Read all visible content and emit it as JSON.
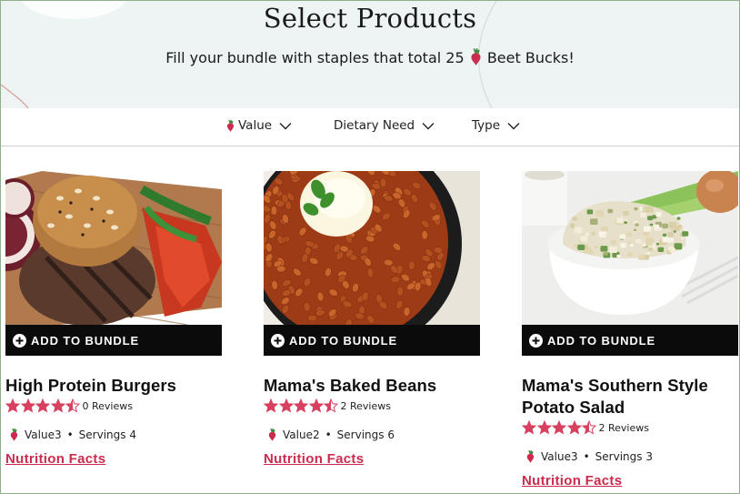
{
  "hero": {
    "title": "Select Products",
    "subtitle_before": "Fill your bundle with staples that total 25",
    "subtitle_after": "Beet Bucks!"
  },
  "filters": [
    {
      "label": "Value",
      "icon": "beet-icon"
    },
    {
      "label": "Dietary Need"
    },
    {
      "label": "Type"
    }
  ],
  "colors": {
    "accent": "#cc2b4e",
    "star": "#d7405e",
    "hero_bg": "#eef3f3",
    "button_bg": "#0b0b0b"
  },
  "add_label": "ADD TO BUNDLE",
  "products": [
    {
      "name": "High Protein Burgers",
      "rating": 4.5,
      "reviews": "0 Reviews",
      "value": "Value3",
      "servings": "Servings 4",
      "nutrition": "Nutrition Facts"
    },
    {
      "name": "Mama's Baked Beans",
      "rating": 4.5,
      "reviews": "2 Reviews",
      "value": "Value2",
      "servings": "Servings 6",
      "nutrition": "Nutrition Facts"
    },
    {
      "name": "Mama's Southern Style Potato Salad",
      "rating": 4.5,
      "reviews": "2 Reviews",
      "value": "Value3",
      "servings": "Servings 3",
      "nutrition": "Nutrition Facts"
    }
  ]
}
